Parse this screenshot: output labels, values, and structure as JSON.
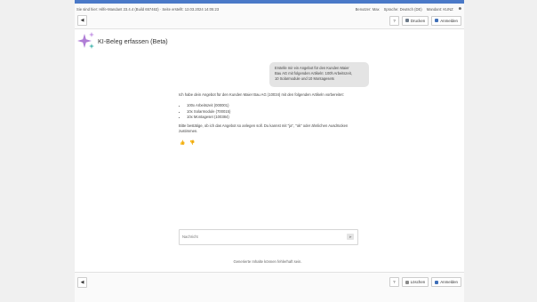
{
  "status_bar": {
    "left_text": "Sie sind hier: Hilfe-Mandant 23.4.4 (Build 657463) · Seite erstellt: 12.03.2024 14:05:23",
    "items": [
      "Benutzer: Max",
      "Sprache: Deutsch (DE)",
      "Mandant: KUNZ"
    ]
  },
  "toolbar": {
    "back_icon": "back-arrow-icon",
    "help_label": "?",
    "print_label": "Drucken",
    "save_label": "Anmelden"
  },
  "header": {
    "title": "KI-Beleg erfassen (Beta)",
    "icon": "sparkle-icon"
  },
  "chat": {
    "user_message_lines": [
      "Erstelle mir ein Angebot für den Kunden Maier",
      "Bau AG mit folgenden Artikeln: 100h Arbeitszeit,",
      "10 Solarmodule und 10 Montagesets"
    ],
    "ai_intro": "Ich habe dein Angebot für den Kunden Maier Bau AG (10034) mit den folgenden Artikeln vorbereitet:",
    "ai_items": [
      "100x Arbeitszeit (000001)",
      "10x Solarmodule (700015)",
      "10x Montageset (100384)"
    ],
    "ai_outro": "Bitte bestätige, ob ich das Angebot so anlegen soll. Du kannst mit \"ja\", \"ok\" oder ähnlichen Ausdrücken zustimmen.",
    "thumbs_up_icon": "thumbs-up-icon",
    "thumbs_down_icon": "thumbs-down-icon"
  },
  "input": {
    "placeholder": "Nachricht",
    "send_icon": "send-icon"
  },
  "disclaimer": "Generierte Inhalte können fehlerhaft sein.",
  "footer": {
    "back_icon": "back-arrow-icon",
    "help_label": "?",
    "delete_label": "Löschen",
    "save_label": "Anmelden"
  },
  "colors": {
    "accent": "#4a79c8",
    "sparkle_purple": "#b07ed6",
    "sparkle_teal": "#4db8b0"
  }
}
